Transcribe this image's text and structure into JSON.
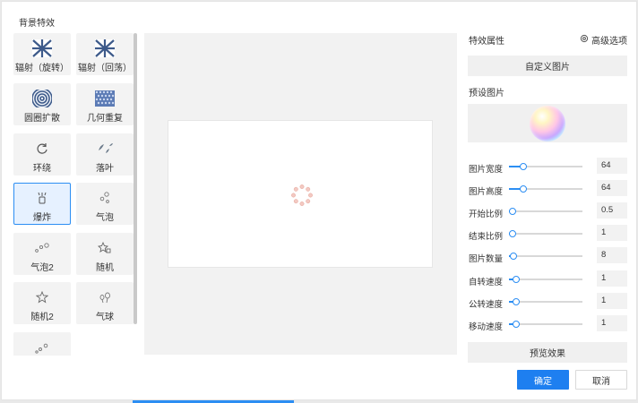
{
  "dialog": {
    "title": "背景特效"
  },
  "effects": [
    {
      "label": "辐射（旋转）",
      "icon": "radial-burst-icon",
      "selected": false
    },
    {
      "label": "辐射（回荡）",
      "icon": "radial-burst-icon",
      "selected": false
    },
    {
      "label": "圆圈扩散",
      "icon": "concentric-circles-icon",
      "selected": false
    },
    {
      "label": "几何重复",
      "icon": "geometric-pattern-icon",
      "selected": false
    },
    {
      "label": "环绕",
      "icon": "orbit-arrows-icon",
      "selected": false
    },
    {
      "label": "落叶",
      "icon": "falling-leaves-icon",
      "selected": false
    },
    {
      "label": "爆炸",
      "icon": "explosion-icon",
      "selected": true
    },
    {
      "label": "气泡",
      "icon": "bubbles-icon",
      "selected": false
    },
    {
      "label": "气泡2",
      "icon": "bubbles-icon",
      "selected": false
    },
    {
      "label": "随机",
      "icon": "random-shapes-icon",
      "selected": false
    },
    {
      "label": "随机2",
      "icon": "star-icon",
      "selected": false
    },
    {
      "label": "气球",
      "icon": "balloons-icon",
      "selected": false
    },
    {
      "label": "",
      "icon": "bubbles-icon",
      "selected": false
    }
  ],
  "properties": {
    "title": "特效属性",
    "advanced_label": "高级选项",
    "custom_image_label": "自定义图片",
    "preset_label": "预设图片",
    "sliders": [
      {
        "label": "图片宽度",
        "value": "64",
        "fraction": 0.19
      },
      {
        "label": "图片高度",
        "value": "64",
        "fraction": 0.19
      },
      {
        "label": "开始比例",
        "value": "0.5",
        "fraction": 0.05
      },
      {
        "label": "结束比例",
        "value": "1",
        "fraction": 0.05
      },
      {
        "label": "图片数量",
        "value": "8",
        "fraction": 0.06
      },
      {
        "label": "自转速度",
        "value": "1",
        "fraction": 0.1
      },
      {
        "label": "公转速度",
        "value": "1",
        "fraction": 0.1
      },
      {
        "label": "移动速度",
        "value": "1",
        "fraction": 0.1
      }
    ],
    "preview_label": "预览效果"
  },
  "footer": {
    "ok_label": "确定",
    "cancel_label": "取消"
  },
  "colors": {
    "accent": "#1e7ff0",
    "selected_bg": "#e6f1ff"
  }
}
